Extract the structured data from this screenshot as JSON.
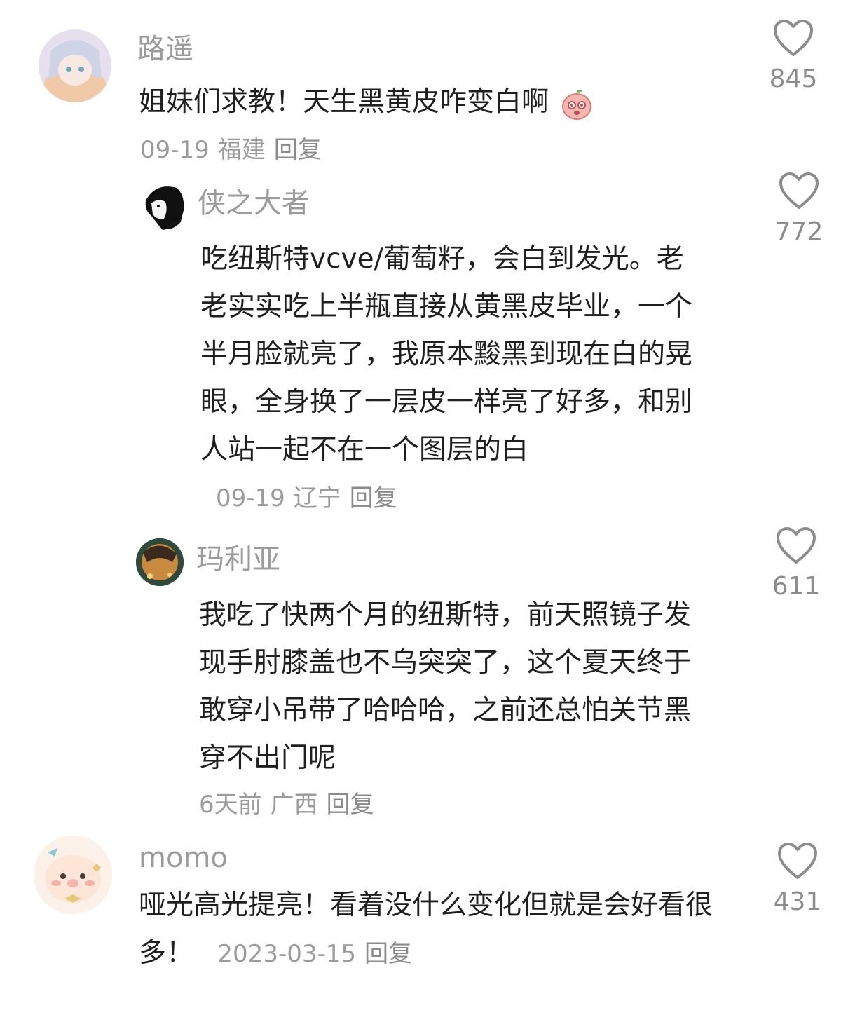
{
  "comments": [
    {
      "username": "路遥",
      "text": "姐妹们求教！天生黑黄皮咋变白啊",
      "emoji": "crying-peach-emoji",
      "date": "09-19",
      "location": "福建",
      "reply_label": "回复",
      "likes": "845"
    },
    {
      "username": "侠之大者",
      "text": "吃纽斯特vcve/葡萄籽，会白到发光。老老实实吃上半瓶直接从黄黑皮毕业，一个半月脸就亮了，我原本黢黑到现在白的晃眼，全身换了一层皮一样亮了好多，和别人站一起不在一个图层的白",
      "date": "09-19",
      "location": "辽宁",
      "reply_label": "回复",
      "likes": "772"
    },
    {
      "username": "玛利亚",
      "text": "我吃了快两个月的纽斯特，前天照镜子发现手肘膝盖也不乌突突了，这个夏天终于敢穿小吊带了哈哈哈，之前还总怕关节黑穿不出门呢",
      "date": "6天前",
      "location": "广西",
      "reply_label": "回复",
      "likes": "611"
    },
    {
      "username": "momo",
      "text": "哑光高光提亮！看着没什么变化但就是会好看很多！",
      "date": "2023-03-15",
      "reply_label": "回复",
      "likes": "431"
    }
  ],
  "icons": {
    "like": "heart-outline-icon",
    "like_color": "#8c8c8c"
  }
}
